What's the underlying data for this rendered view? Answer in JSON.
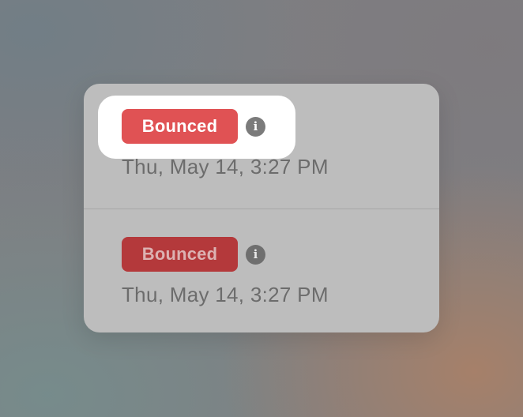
{
  "items": [
    {
      "status_label": "Bounced",
      "info_glyph": "i",
      "timestamp": "Thu, May 14, 3:27 PM",
      "highlighted": true,
      "badge_color": "#e05254"
    },
    {
      "status_label": "Bounced",
      "info_glyph": "i",
      "timestamp": "Thu, May 14, 3:27 PM",
      "highlighted": false,
      "badge_color": "#b4393b"
    }
  ],
  "icons": {
    "info": "info-icon"
  }
}
